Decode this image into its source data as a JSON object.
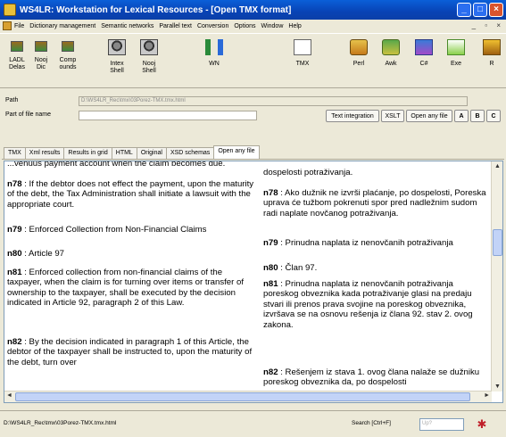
{
  "window": {
    "title": "WS4LR: Workstation for Lexical Resources - [Open TMX format]",
    "controls": [
      "_",
      "□",
      "×"
    ]
  },
  "menu": {
    "items": [
      "File",
      "Dictionary management",
      "Semantic networks",
      "Parallel text",
      "Conversion",
      "Options",
      "Window",
      "Help"
    ],
    "mdi_controls": "_ ▫ ×"
  },
  "toolbar": {
    "buttons": [
      {
        "label": "LADL\nDelas",
        "icon": "dictionary-icon"
      },
      {
        "label": "Nooj\nDic",
        "icon": "dictionary-icon"
      },
      {
        "label": "Comp\nounds",
        "icon": "dictionary-icon"
      },
      {
        "label": "Intex\nShell",
        "icon": "shell-icon"
      },
      {
        "label": "Nooj\nShell",
        "icon": "shell-icon"
      },
      {
        "label": "WN",
        "icon": "wordnet-icon"
      },
      {
        "label": "TMX",
        "icon": "tmx-icon"
      },
      {
        "label": "Perl",
        "icon": "perl-icon"
      },
      {
        "label": "Awk",
        "icon": "awk-icon"
      },
      {
        "label": "C#",
        "icon": "csharp-icon"
      },
      {
        "label": "Exe",
        "icon": "exe-icon"
      },
      {
        "label": "R",
        "icon": "r-icon"
      }
    ]
  },
  "pathpanel": {
    "path_label": "Path",
    "path_value": "D:\\WS4LR_Rec\\tmx\\03Porez-TMX.tmx.html",
    "part_label": "Part of file name",
    "part_value": "",
    "buttons": [
      "Text integration",
      "XSLT",
      "Open any file",
      "A",
      "B",
      "C"
    ]
  },
  "tabs": {
    "items": [
      "TMX",
      "Xml results",
      "Results in grid",
      "HTML",
      "Original",
      "XSD schemas",
      "Open any file"
    ],
    "active_index": 6
  },
  "content": {
    "english": [
      {
        "id": "",
        "text": "...venuus payment account when the claim becomes due."
      },
      {
        "id": "n78",
        "text": "If the debtor does not effect the payment, upon the maturity of the debt, the Tax Administration shall initiate a lawsuit with the appropriate court."
      },
      {
        "id": "n79",
        "text": "Enforced Collection from Non-Financial Claims"
      },
      {
        "id": "n80",
        "text": "Article 97"
      },
      {
        "id": "n81",
        "text": "Enforced collection from non-financial claims of the taxpayer, when the claim is for turning over items or transfer of ownership to the taxpayer, shall be executed by the decision indicated in Article 92, paragraph 2 of this Law."
      },
      {
        "id": "n82",
        "text": "By the decision indicated in paragraph 1 of this Article, the debtor of the taxpayer shall be instructed to, upon the maturity of the debt, turn over"
      }
    ],
    "serbian": [
      {
        "id": "",
        "text": "dospelosti potraživanja."
      },
      {
        "id": "n78",
        "text": "Ako dužnik ne izvrši plaćanje, po dospelosti, Poreska uprava će tužbom pokrenuti spor pred nadležnim sudom radi naplate novčanog potraživanja."
      },
      {
        "id": "n79",
        "text": "Prinudna naplata iz nenovčanih potraživanja"
      },
      {
        "id": "n80",
        "text": "Član 97."
      },
      {
        "id": "n81",
        "text": "Prinudna naplata iz nenovčanih potraživanja poreskog obveznika kada potraživanje glasi na predaju stvari ili prenos prava svojine na poreskog obveznika, izvršava se na osnovu rešenja iz člana 92. stav 2. ovog zakona."
      },
      {
        "id": "n82",
        "text": "Rešenjem iz stava 1. ovog člana nalaže se dužniku poreskog obveznika da, po dospelosti"
      }
    ]
  },
  "statusbar": {
    "file": "D:\\WS4LR_Rec\\tmx\\03Porez-TMX.tmx.html",
    "search_label": "Search [Ctrl+F]",
    "search_placeholder": "Up?"
  }
}
